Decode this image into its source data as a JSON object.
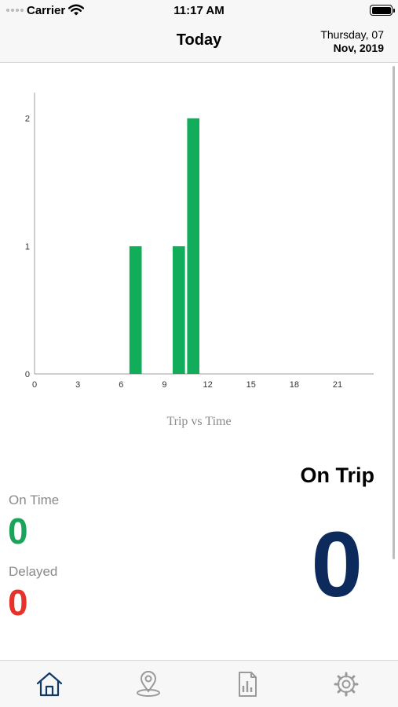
{
  "status_bar": {
    "carrier": "Carrier",
    "time": "11:17 AM"
  },
  "nav": {
    "title": "Today",
    "date_line1": "Thursday, 07",
    "date_line2": "Nov, 2019"
  },
  "chart_data": {
    "type": "bar",
    "title": "Trip vs Time",
    "xlabel": "",
    "ylabel": "",
    "x_ticks": [
      0,
      3,
      6,
      9,
      12,
      15,
      18,
      21
    ],
    "y_ticks": [
      0,
      1,
      2
    ],
    "xlim": [
      0,
      23.5
    ],
    "ylim": [
      0,
      2.2
    ],
    "bars": [
      {
        "x": 7,
        "value": 1
      },
      {
        "x": 10,
        "value": 1
      },
      {
        "x": 11,
        "value": 2
      }
    ],
    "color": "#12ad5b"
  },
  "stats": {
    "on_time_label": "On Time",
    "on_time_value": "0",
    "delayed_label": "Delayed",
    "delayed_value": "0",
    "on_trip_label": "On Trip",
    "on_trip_value": "0"
  },
  "colors": {
    "on_time": "#1aa45a",
    "delayed": "#e5332a",
    "on_trip": "#0d2a5c",
    "tab_active": "#0d3b66",
    "tab_inactive": "#9a9a9a"
  },
  "tabs": [
    {
      "icon": "home-icon",
      "active": true
    },
    {
      "icon": "map-pin-icon",
      "active": false
    },
    {
      "icon": "report-icon",
      "active": false
    },
    {
      "icon": "gear-icon",
      "active": false
    }
  ]
}
